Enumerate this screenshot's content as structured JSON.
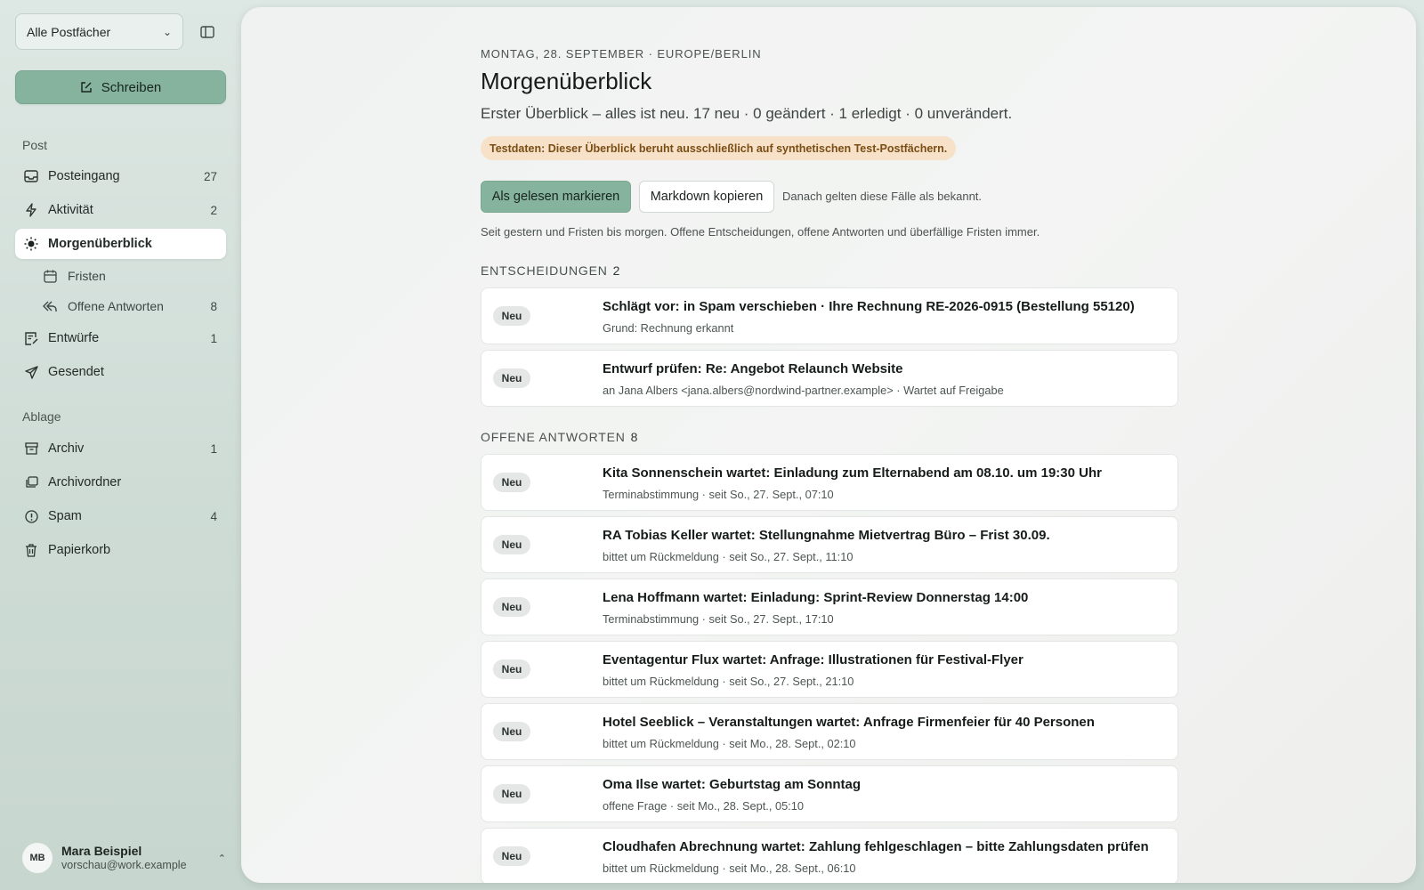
{
  "sidebar": {
    "mailbox_select": "Alle Postfächer",
    "compose_label": "Schreiben",
    "section_post": "Post",
    "section_ablage": "Ablage",
    "items": {
      "posteingang": {
        "label": "Posteingang",
        "count": "27"
      },
      "aktivitaet": {
        "label": "Aktivität",
        "count": "2"
      },
      "morgenueberblick": {
        "label": "Morgenüberblick"
      },
      "fristen": {
        "label": "Fristen"
      },
      "offene_antworten": {
        "label": "Offene Antworten",
        "count": "8"
      },
      "entwuerfe": {
        "label": "Entwürfe",
        "count": "1"
      },
      "gesendet": {
        "label": "Gesendet"
      },
      "archiv": {
        "label": "Archiv",
        "count": "1"
      },
      "archivordner": {
        "label": "Archivordner"
      },
      "spam": {
        "label": "Spam",
        "count": "4"
      },
      "papierkorb": {
        "label": "Papierkorb"
      }
    },
    "user": {
      "initials": "MB",
      "name": "Mara Beispiel",
      "email": "vorschau@work.example"
    }
  },
  "main": {
    "date_line": "MONTAG, 28. SEPTEMBER · EUROPE/BERLIN",
    "title": "Morgenüberblick",
    "summary": "Erster Überblick – alles ist neu. 17 neu · 0 geändert · 1 erledigt · 0 unverändert.",
    "test_badge": "Testdaten: Dieser Überblick beruht ausschließlich auf synthetischen Test-Postfächern.",
    "mark_read_label": "Als gelesen markieren",
    "copy_markdown_label": "Markdown kopieren",
    "button_hint": "Danach gelten diese Fälle als bekannt.",
    "scope_note": "Seit gestern und Fristen bis morgen. Offene Entscheidungen, offene Antworten und überfällige Fristen immer.",
    "groups": [
      {
        "label": "ENTSCHEIDUNGEN",
        "count": "2",
        "cards": [
          {
            "badge": "Neu",
            "title": "Schlägt vor: in Spam verschieben · Ihre Rechnung RE-2026-0915 (Bestellung 55120)",
            "meta": "Grund: Rechnung erkannt"
          },
          {
            "badge": "Neu",
            "title": "Entwurf prüfen: Re: Angebot Relaunch Website",
            "meta": "an Jana Albers <jana.albers@nordwind-partner.example> · Wartet auf Freigabe"
          }
        ]
      },
      {
        "label": "OFFENE ANTWORTEN",
        "count": "8",
        "cards": [
          {
            "badge": "Neu",
            "title": "Kita Sonnenschein wartet: Einladung zum Elternabend am 08.10. um 19:30 Uhr",
            "meta": "Terminabstimmung · seit So., 27. Sept., 07:10"
          },
          {
            "badge": "Neu",
            "title": "RA Tobias Keller wartet: Stellungnahme Mietvertrag Büro – Frist 30.09.",
            "meta": "bittet um Rückmeldung · seit So., 27. Sept., 11:10"
          },
          {
            "badge": "Neu",
            "title": "Lena Hoffmann wartet: Einladung: Sprint-Review Donnerstag 14:00",
            "meta": "Terminabstimmung · seit So., 27. Sept., 17:10"
          },
          {
            "badge": "Neu",
            "title": "Eventagentur Flux wartet: Anfrage: Illustrationen für Festival-Flyer",
            "meta": "bittet um Rückmeldung · seit So., 27. Sept., 21:10"
          },
          {
            "badge": "Neu",
            "title": "Hotel Seeblick – Veranstaltungen wartet: Anfrage Firmenfeier für 40 Personen",
            "meta": "bittet um Rückmeldung · seit Mo., 28. Sept., 02:10"
          },
          {
            "badge": "Neu",
            "title": "Oma Ilse wartet: Geburtstag am Sonntag",
            "meta": "offene Frage · seit Mo., 28. Sept., 05:10"
          },
          {
            "badge": "Neu",
            "title": "Cloudhafen Abrechnung wartet: Zahlung fehlgeschlagen – bitte Zahlungsdaten prüfen",
            "meta": "bittet um Rückmeldung · seit Mo., 28. Sept., 06:10"
          }
        ]
      }
    ]
  }
}
